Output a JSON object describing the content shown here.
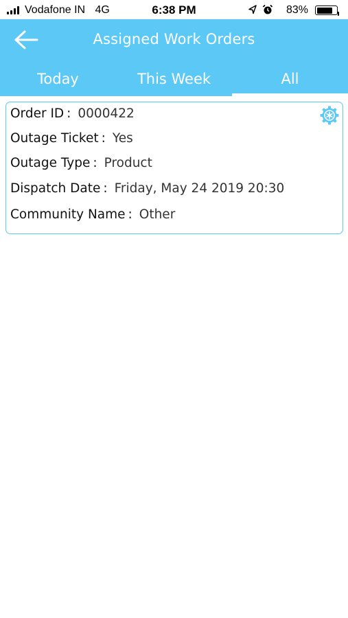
{
  "status_bar": {
    "carrier": "Vodafone IN",
    "network": "4G",
    "time": "6:38 PM",
    "battery_percent": "83%",
    "battery_level": 0.83,
    "icons": [
      "signal-icon",
      "location-icon",
      "alarm-icon",
      "battery-icon"
    ]
  },
  "header": {
    "title": "Assigned Work Orders",
    "back_icon": "arrow-left-icon",
    "background_color": "#5bc8f5"
  },
  "tabs": [
    {
      "label": "Today",
      "selected": false
    },
    {
      "label": "This Week",
      "selected": false
    },
    {
      "label": "All",
      "selected": true
    }
  ],
  "order": {
    "settings_icon": "gear-icon",
    "fields": [
      {
        "label": "Order ID",
        "separator": ":",
        "value": "0000422"
      },
      {
        "label": "Outage Ticket",
        "separator": ":",
        "value": "Yes"
      },
      {
        "label": "Outage Type",
        "separator": ":",
        "value": "Product"
      },
      {
        "label": "Dispatch Date",
        "separator": ":",
        "value": "Friday, May 24 2019 20:30"
      },
      {
        "label": "Community Name",
        "separator": ":",
        "value": "Other"
      }
    ]
  }
}
